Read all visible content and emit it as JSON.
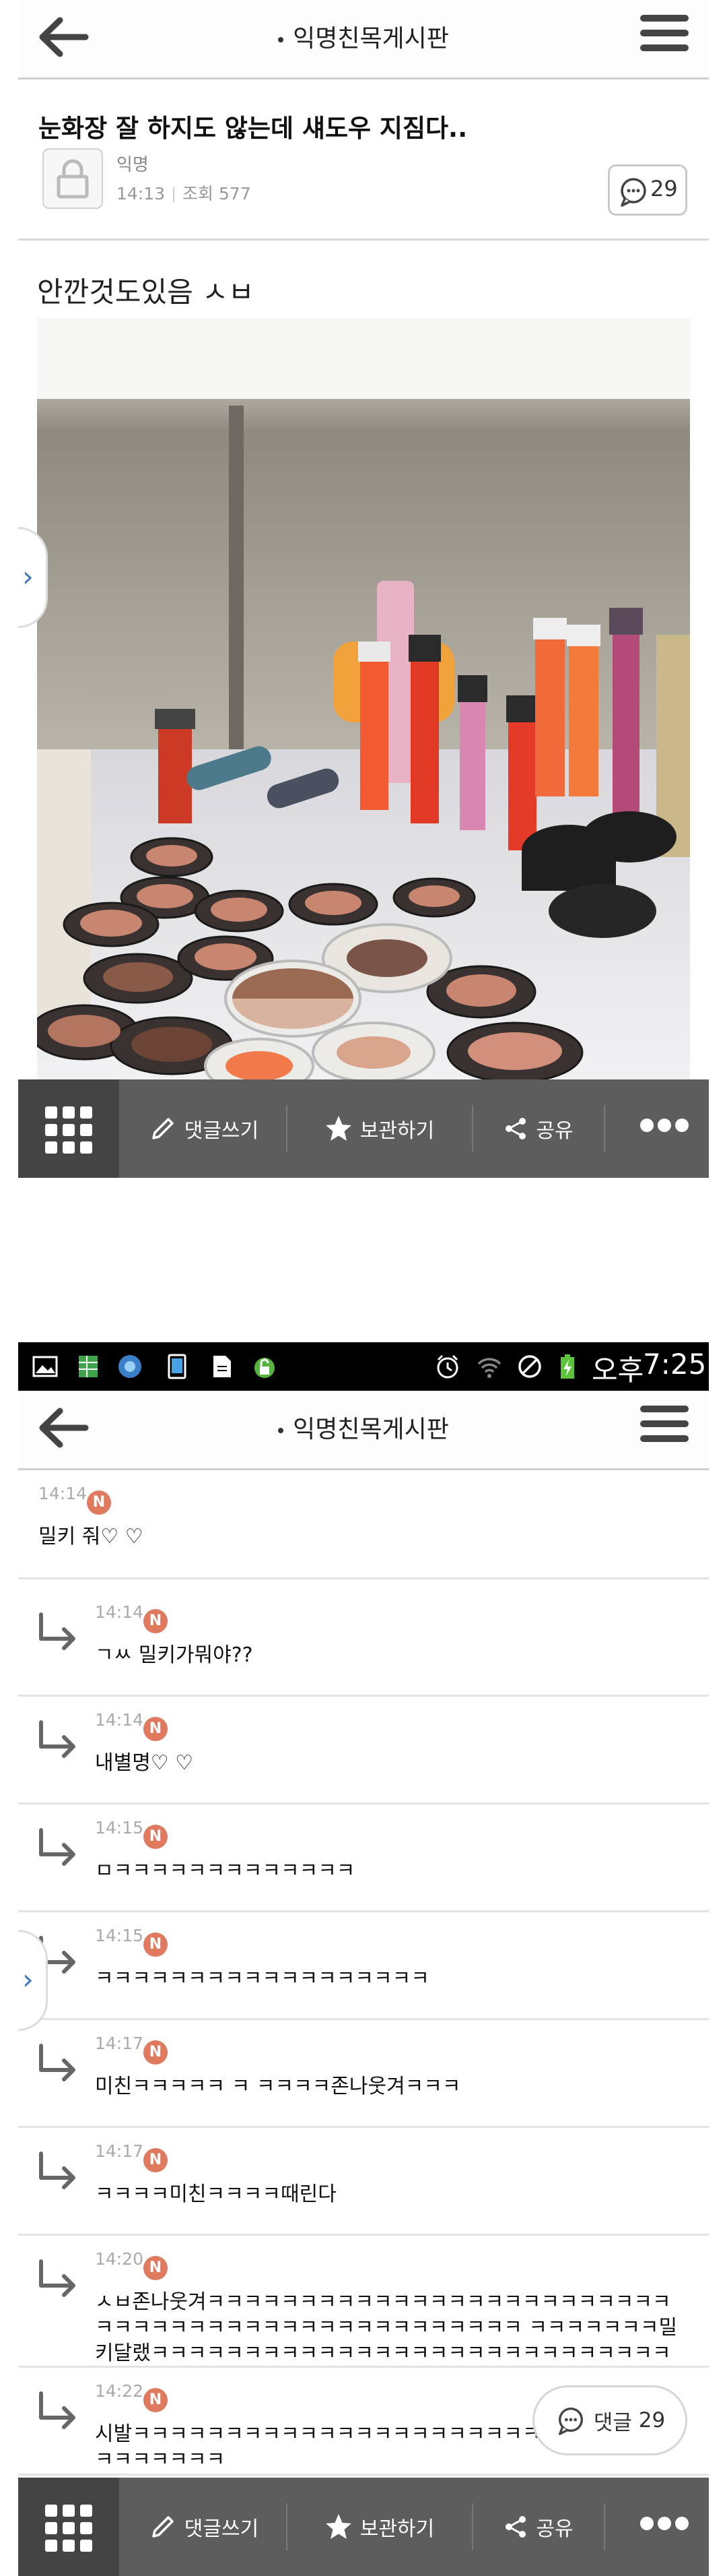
{
  "header": {
    "title": "익명친목게시판"
  },
  "post": {
    "title": "눈화장 잘 하지도 않는데 섀도우 지짐다..",
    "author": "익명",
    "time": "14:13",
    "views_label": "조회",
    "views": "577",
    "comment_count": "29",
    "body": "안깐것도있음 ㅅㅂ"
  },
  "toolbar": {
    "write_comment": "댓글쓰기",
    "save": "보관하기",
    "share": "공유"
  },
  "status_bar": {
    "ampm": "오후",
    "time": "7:25"
  },
  "comments": [
    {
      "time": "14:14",
      "badge": "N",
      "text": "밀키 줘♡ ♡",
      "reply": false
    },
    {
      "time": "14:14",
      "badge": "N",
      "text": "ㄱㅆ 밀키가뭐야??",
      "reply": true
    },
    {
      "time": "14:14",
      "badge": "N",
      "text": "내별명♡ ♡",
      "reply": true
    },
    {
      "time": "14:15",
      "badge": "N",
      "text": "ㅁㅋㅋㅋㅋㅋㅋㅋㅋㅋㅋㅋㅋㅋ",
      "reply": true
    },
    {
      "time": "14:15",
      "badge": "N",
      "text": "ㅋㅋㅋㅋㅋㅋㅋㅋㅋㅋㅋㅋㅋㅋㅋㅋㅋㅋ",
      "reply": true
    },
    {
      "time": "14:17",
      "badge": "N",
      "text": "미친ㅋㅋㅋㅋㅋ ㅋ ㅋㅋㅋㅋ존나웃겨ㅋㅋㅋ",
      "reply": true
    },
    {
      "time": "14:17",
      "badge": "N",
      "text": "ㅋㅋㅋㅋ미친ㅋㅋㅋㅋ때린다",
      "reply": true
    },
    {
      "time": "14:20",
      "badge": "N",
      "text": "ㅅㅂ존나웃겨ㅋㅋㅋㅋㅋㅋㅋㅋㅋㅋㅋㅋㅋㅋㅋㅋㅋㅋㅋㅋㅋㅋㅋㅋㅋㅋㅋㅋㅋㅋㅋㅋㅋㅋㅋㅋㅋㅋㅋㅋㅋㅋㅋㅋㅋㅋㅋㅋ ㅋㅋㅋㅋㅋㅋㅋ밀키달랬ㅋㅋㅋㅋㅋㅋㅋㅋㅋㅋㅋㅋㅋㅋㅋㅋㅋㅋㅋㅋㅋㅋㅋㅋㅋㅋㅋㅋㅋㅋㅋ",
      "reply": true
    },
    {
      "time": "14:22",
      "badge": "N",
      "text": "시발ㅋㅋㅋㅋㅋㅋㅋㅋㅋㅋㅋㅋㅋㅋㅋㅋㅋㅋㅋㅋㅋㅋㅋㅋㅋㅋㅋㅋㅋㅋㅋㅋㅋㅋㅋㅋ",
      "reply": true
    }
  ],
  "floating_comment": {
    "label": "댓글",
    "count": "29"
  },
  "colors": {
    "toolbar": "#5d5d5d",
    "badge": "#e07a5f",
    "side_tab_arrow": "#3b78c2"
  }
}
